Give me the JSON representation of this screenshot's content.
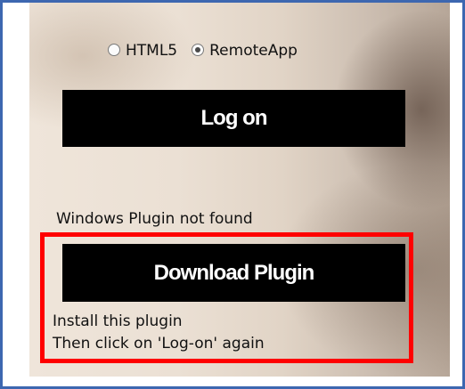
{
  "radio_options": [
    {
      "label": "HTML5",
      "checked": false
    },
    {
      "label": "RemoteApp",
      "checked": true
    }
  ],
  "logon_button": {
    "label": "Log on"
  },
  "plugin_status": "Windows Plugin not found",
  "download_button": {
    "label": "Download Plugin"
  },
  "instructions": [
    "Install this plugin",
    "Then click on 'Log-on' again"
  ],
  "colors": {
    "frame_border": "#3d67b0",
    "highlight_box": "#ff0000",
    "button_bg": "#000000",
    "button_text": "#ffffff"
  }
}
